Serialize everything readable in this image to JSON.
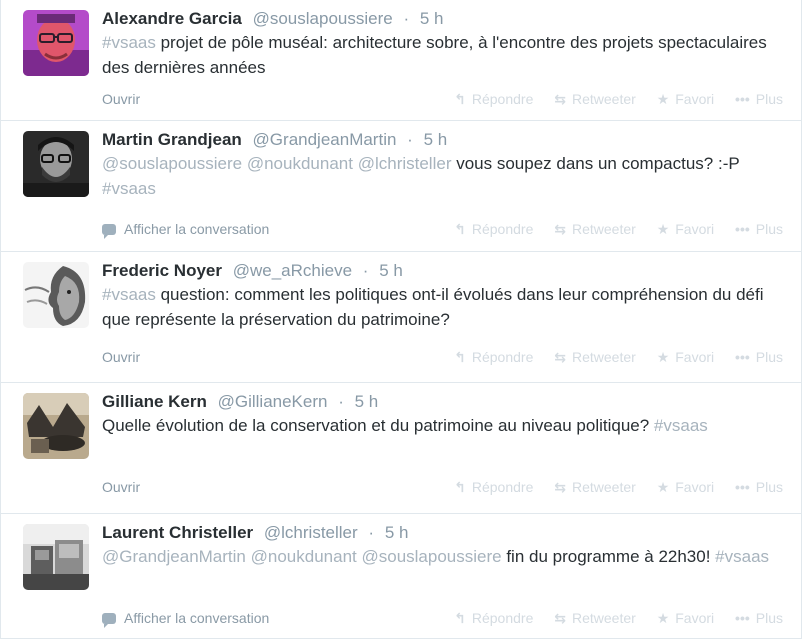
{
  "tweets": [
    {
      "fullname": "Alexandre Garcia",
      "username": "@souslapoussiere",
      "time": "5 h",
      "segments": [
        {
          "t": "tag",
          "v": "#vsaas"
        },
        {
          "t": "text",
          "v": " projet de pôle muséal: architecture sobre, à l'encontre des projets spectaculaires des dernières années"
        }
      ],
      "footer_left": "Ouvrir",
      "footer_conv": false
    },
    {
      "fullname": "Martin Grandjean",
      "username": "@GrandjeanMartin",
      "time": "5 h",
      "segments": [
        {
          "t": "mention",
          "v": "@souslapoussiere"
        },
        {
          "t": "text",
          "v": " "
        },
        {
          "t": "mention",
          "v": "@noukdunant"
        },
        {
          "t": "text",
          "v": " "
        },
        {
          "t": "mention",
          "v": "@lchristeller"
        },
        {
          "t": "text",
          "v": " vous soupez dans un compactus? :-P "
        },
        {
          "t": "tag",
          "v": "#vsaas"
        }
      ],
      "footer_left": "Afficher la conversation",
      "footer_conv": true
    },
    {
      "fullname": "Frederic Noyer",
      "username": "@we_aRchieve",
      "time": "5 h",
      "segments": [
        {
          "t": "tag",
          "v": "#vsaas"
        },
        {
          "t": "text",
          "v": " question: comment les politiques ont-il évolués dans leur compréhension du défi que représente la préservation du patrimoine?"
        }
      ],
      "footer_left": "Ouvrir",
      "footer_conv": false
    },
    {
      "fullname": "Gilliane Kern",
      "username": "@GillianeKern",
      "time": "5 h",
      "segments": [
        {
          "t": "text",
          "v": "Quelle évolution de la conservation et du patrimoine au niveau politique? "
        },
        {
          "t": "tag",
          "v": "#vsaas"
        }
      ],
      "footer_left": "Ouvrir",
      "footer_conv": false
    },
    {
      "fullname": "Laurent Christeller",
      "username": "@lchristeller",
      "time": "5 h",
      "segments": [
        {
          "t": "mention",
          "v": "@GrandjeanMartin"
        },
        {
          "t": "text",
          "v": " "
        },
        {
          "t": "mention",
          "v": "@noukdunant"
        },
        {
          "t": "text",
          "v": " "
        },
        {
          "t": "mention",
          "v": "@souslapoussiere"
        },
        {
          "t": "text",
          "v": " fin du programme à 22h30! "
        },
        {
          "t": "tag",
          "v": "#vsaas"
        }
      ],
      "footer_left": "Afficher la conversation",
      "footer_conv": true
    }
  ],
  "actions": {
    "reply": "Répondre",
    "retweet": "Retweeter",
    "favorite": "Favori",
    "more": "Plus"
  },
  "separator": "·",
  "icons": {
    "reply": "reply-arrow-icon",
    "retweet": "retweet-icon",
    "favorite": "star-icon",
    "more": "ellipsis-icon",
    "conversation": "speech-bubble-icon"
  },
  "colors": {
    "link_faded": "#a7b3bd",
    "meta": "#8899a6",
    "action_faded": "#d4dbe1",
    "text": "#292f33"
  }
}
